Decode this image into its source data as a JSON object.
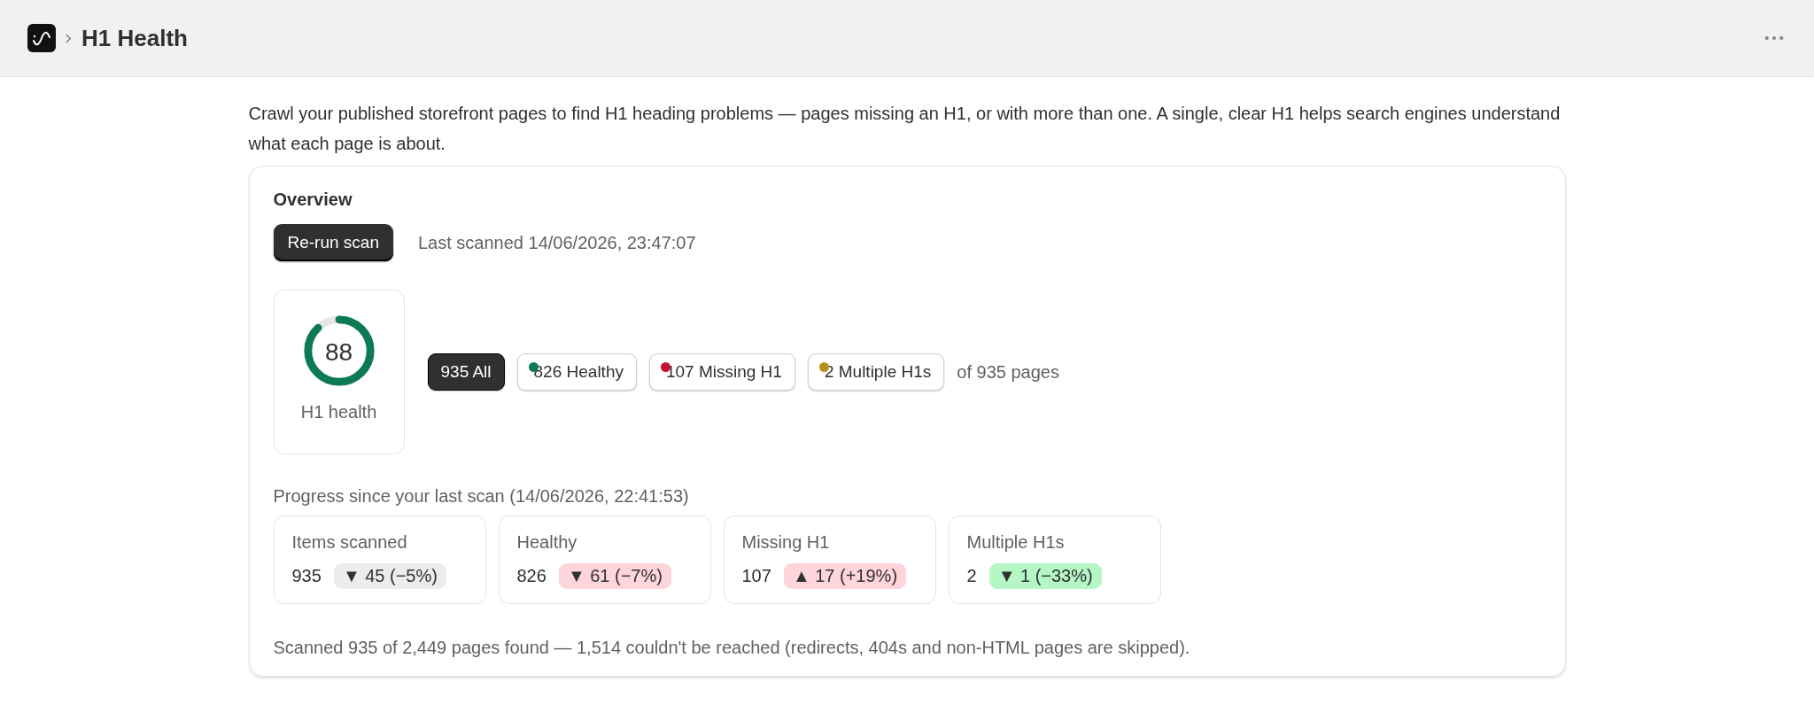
{
  "header": {
    "title": "H1 Health"
  },
  "description": "Crawl your published storefront pages to find H1 heading problems — pages missing an H1, or with more than one. A single, clear H1 helps search engines understand what each page is about.",
  "overview": {
    "title": "Overview",
    "rerun_button": "Re-run scan",
    "last_scanned": "Last scanned 14/06/2026, 23:47:07",
    "score": {
      "value": "88",
      "label": "H1 health",
      "level": 0.88
    },
    "filters": [
      {
        "label": "935 All",
        "selected": true
      },
      {
        "label": "826 Healthy",
        "selected": false,
        "color": "#0b7a55"
      },
      {
        "label": "107 Missing H1",
        "selected": false,
        "color": "#c8102e"
      },
      {
        "label": "2 Multiple H1s",
        "selected": false,
        "color": "#b8901a"
      }
    ],
    "filters_note": "of 935 pages",
    "progress_title": "Progress since your last scan (14/06/2026, 22:41:53)",
    "stats": [
      {
        "label": "Items scanned",
        "value": "935",
        "delta": "▼ 45 (−5%)",
        "color": "#ececec"
      },
      {
        "label": "Healthy",
        "value": "826",
        "delta": "▼ 61 (−7%)",
        "color": "#fdd5da"
      },
      {
        "label": "Missing H1",
        "value": "107",
        "delta": "▲ 17 (+19%)",
        "color": "#fdd5da"
      },
      {
        "label": "Multiple H1s",
        "value": "2",
        "delta": "▼ 1 (−33%)",
        "color": "#b4f6c4"
      }
    ],
    "footnote": "Scanned 935 of 2,449 pages found — 1,514 couldn't be reached (redirects, 404s and non-HTML pages are skipped)."
  }
}
